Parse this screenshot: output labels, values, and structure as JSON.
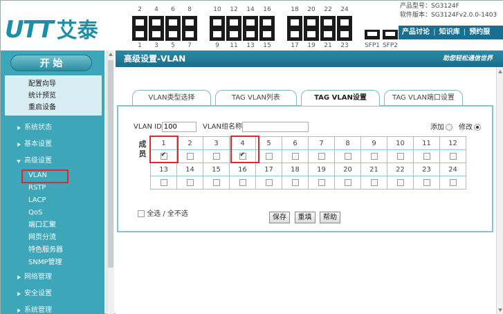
{
  "header": {
    "logo_text": "UTT",
    "logo_cn": "艾泰",
    "ports_top": [
      "2",
      "4",
      "6",
      "8",
      "10",
      "12",
      "14",
      "16",
      "18",
      "20",
      "22",
      "24"
    ],
    "ports_bottom": [
      "1",
      "3",
      "5",
      "7",
      "9",
      "11",
      "13",
      "15",
      "17",
      "19",
      "21",
      "23"
    ],
    "sfp_labels": [
      "SFP1",
      "SFP2"
    ],
    "model_line": "产品型号：SG3124F",
    "version_line": "软件版本：SG3124Fv2.0.0-1403",
    "top_links": [
      "产品讨论",
      "知识库",
      "预约服"
    ]
  },
  "sidebar": {
    "start_label": "开 始",
    "quick_items": [
      "配置向导",
      "统计预览",
      "重启设备"
    ],
    "categories": {
      "status": "系统状态",
      "basic": "基本设置",
      "advanced": "高级设置",
      "network": "网络管理",
      "security": "安全设置",
      "system": "系统管理"
    },
    "advanced_items": [
      "VLAN",
      "RSTP",
      "LACP",
      "QoS",
      "端口汇聚",
      "网页分流",
      "特色服务器",
      "SNMP管理"
    ]
  },
  "main": {
    "title": "高级设置-VLAN",
    "slogan": "助您轻松通信世界",
    "tabs": [
      "VLAN类型选择",
      "TAG VLAN列表",
      "TAG VLAN设置",
      "TAG VLAN端口设置"
    ],
    "active_tab": 2,
    "vlan_id_label": "VLAN ID",
    "vlan_id_value": "100",
    "vlan_name_label": "VLAN组名称",
    "vlan_name_value": "",
    "add_label": "添加",
    "modify_label": "修改",
    "mode_selected": "修改",
    "member_label_1": "成",
    "member_label_2": "员",
    "ports_row1": [
      "1",
      "2",
      "3",
      "4",
      "5",
      "6",
      "7",
      "8",
      "9",
      "10",
      "11",
      "12"
    ],
    "ports_row2": [
      "13",
      "14",
      "15",
      "16",
      "17",
      "18",
      "19",
      "20",
      "21",
      "22",
      "23",
      "24"
    ],
    "checked_ports": [
      1,
      4
    ],
    "select_all_label": "全选 / 全不选",
    "buttons": {
      "save": "保存",
      "reset": "重填",
      "help": "帮助"
    }
  }
}
